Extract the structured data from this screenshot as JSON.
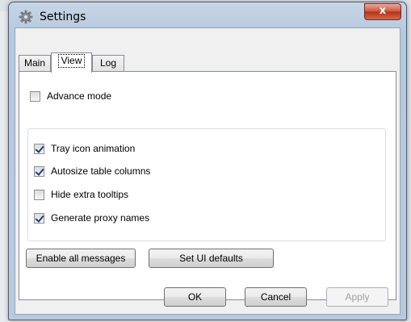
{
  "window": {
    "title": "Settings",
    "close_label": "x"
  },
  "tabs": [
    {
      "label": "Main",
      "active": false
    },
    {
      "label": "View",
      "active": true
    },
    {
      "label": "Log",
      "active": false
    }
  ],
  "view": {
    "advance_mode": {
      "label": "Advance mode",
      "checked": false
    },
    "options": [
      {
        "label": "Tray icon animation",
        "checked": true
      },
      {
        "label": "Autosize table columns",
        "checked": true
      },
      {
        "label": "Hide extra tooltips",
        "checked": false
      },
      {
        "label": "Generate proxy names",
        "checked": true
      }
    ],
    "enable_all_messages": "Enable all messages",
    "set_ui_defaults": "Set UI defaults"
  },
  "footer": {
    "ok": "OK",
    "cancel": "Cancel",
    "apply": "Apply"
  }
}
